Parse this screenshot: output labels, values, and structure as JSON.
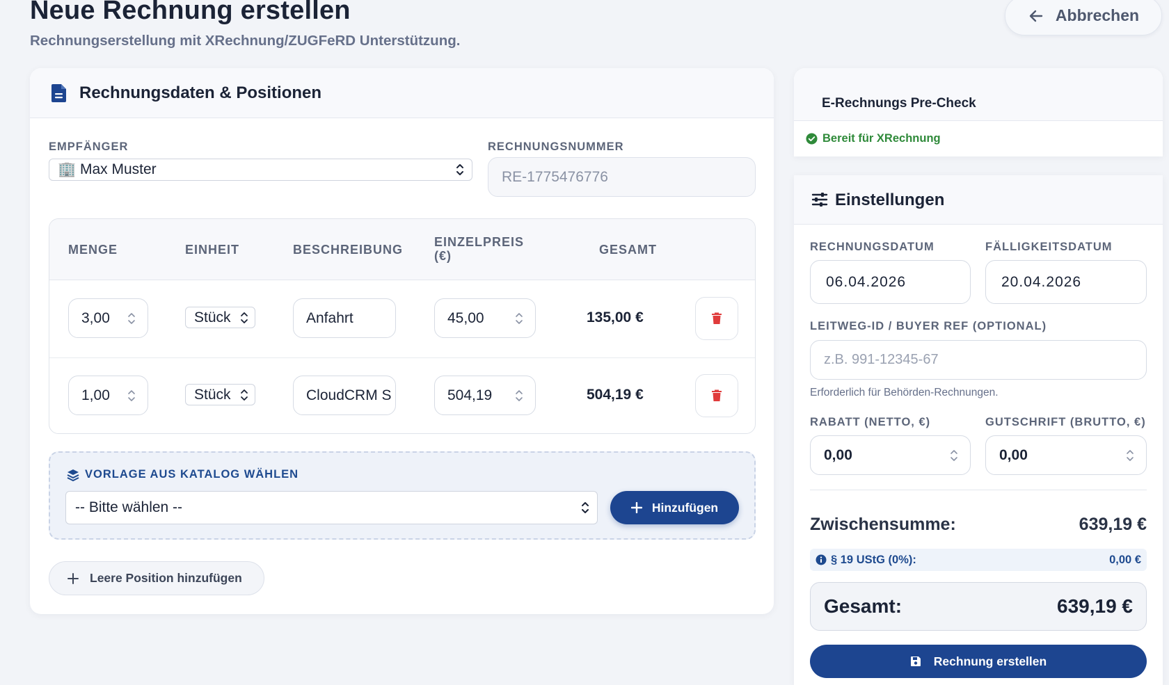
{
  "header": {
    "title": "Neue Rechnung erstellen",
    "subtitle": "Rechnungserstellung mit XRechnung/ZUGFeRD Unterstützung.",
    "cancel_label": "Abbrechen"
  },
  "main": {
    "card_title": "Rechnungsdaten & Positionen",
    "recipient_label": "EMPFÄNGER",
    "recipient_value": "🏢 Max Muster",
    "invoice_number_label": "RECHNUNGSNUMMER",
    "invoice_number_placeholder": "RE-1775476776",
    "table": {
      "columns": [
        "MENGE",
        "EINHEIT",
        "BESCHREIBUNG",
        "EINZELPREIS",
        "(€)",
        "GESAMT"
      ],
      "rows": [
        {
          "quantity": "3,00",
          "unit": "Stück",
          "description": "Anfahrt",
          "unit_price": "45,00",
          "total": "135,00 €"
        },
        {
          "quantity": "1,00",
          "unit": "Stück",
          "description": "CloudCRM S",
          "unit_price": "504,19",
          "total": "504,19 €"
        }
      ]
    },
    "catalog": {
      "label": "VORLAGE AUS KATALOG WÄHLEN",
      "select_value": "-- Bitte wählen --",
      "add_label": "Hinzufügen"
    },
    "empty_position_label": "Leere Position hinzufügen"
  },
  "precheck": {
    "title": "E-Rechnungs Pre-Check",
    "status": "Bereit für XRechnung"
  },
  "settings": {
    "title": "Einstellungen",
    "invoice_date_label": "RECHNUNGSDATUM",
    "invoice_date": "06.04.2026",
    "due_date_label": "FÄLLIGKEITSDATUM",
    "due_date": "20.04.2026",
    "leitweg_label": "LEITWEG-ID / BUYER REF (OPTIONAL)",
    "leitweg_placeholder": "z.B. 991-12345-67",
    "leitweg_hint": "Erforderlich für Behörden-Rechnungen.",
    "discount_label": "RABATT (NETTO, €)",
    "discount_value": "0,00",
    "credit_label": "GUTSCHRIFT (BRUTTO, €)",
    "credit_value": "0,00",
    "subtotal_label": "Zwischensumme:",
    "subtotal_value": "639,19 €",
    "tax_label": "§ 19 UStG (0%):",
    "tax_value": "0,00 €",
    "total_label": "Gesamt:",
    "total_value": "639,19 €",
    "create_label": "Rechnung erstellen"
  },
  "colors": {
    "primary": "#1d4590",
    "success": "#2f8a3a",
    "danger": "#e03b3b",
    "background": "#f2f4f8"
  }
}
